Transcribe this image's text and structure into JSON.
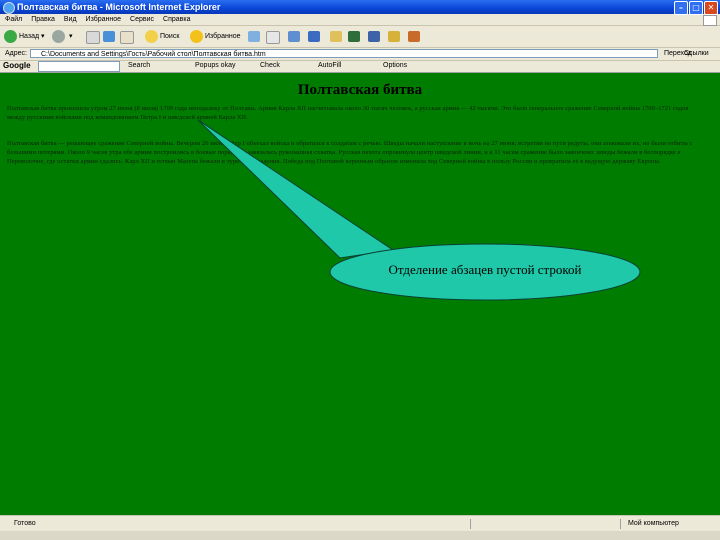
{
  "window": {
    "title": "Полтавская битва - Microsoft Internet Explorer"
  },
  "menu": {
    "items": [
      "Файл",
      "Правка",
      "Вид",
      "Избранное",
      "Сервис",
      "Справка"
    ]
  },
  "toolbar": {
    "back": "Назад",
    "forward": "",
    "search": "Поиск",
    "favorites": "Избранное"
  },
  "address": {
    "label": "Адрес:",
    "value": "C:\\Documents and Settings\\Гость\\Рабочий стол\\Полтавская битва.htm",
    "go": "Переход",
    "links": "Ссылки"
  },
  "google": {
    "logo": "Google",
    "search": "Search",
    "blocked": "Popups okay",
    "check": "Check",
    "autofill": "AutoFill",
    "options": "Options"
  },
  "content": {
    "heading": "Полтавская битва",
    "paragraph1": "Полтавская битва произошла утром 27 июня (8 июля) 1709 года неподалеку от Полтавы. Армия Карла XII насчитывала около 30 тысяч человек, а русская армия — 42 тысячи. Это было генеральное сражение Северной войны 1700–1721 годов между русскими войсками под командованием Петра I и шведской армией Карла XII.",
    "paragraph2": "Полтавская битва — решающее сражение Северной войны. Вечером 26 июня Пётр I объехал войска и обратился к солдатам с речью. Шведы начали наступление в ночь на 27 июня; встретив на пути редуты, они атаковали их, но были отбиты с большими потерями. Около 9 часов утра обе армии построились в боевые порядки и завязалась рукопашная схватка. Русская пехота опрокинула центр шведской линии, и к 11 часам сражение было закончено: шведы бежали в беспорядке к Переволочне, где остатки армии сдались. Карл XII и гетман Мазепа бежали в турецкие владения. Победа под Полтавой коренным образом изменила ход Северной войны в пользу России и превратила её в ведущую державу Европы."
  },
  "callout": {
    "text": "Отделение абзацев пустой строкой"
  },
  "status": {
    "ready": "Готово",
    "zone": "Мой компьютер"
  }
}
